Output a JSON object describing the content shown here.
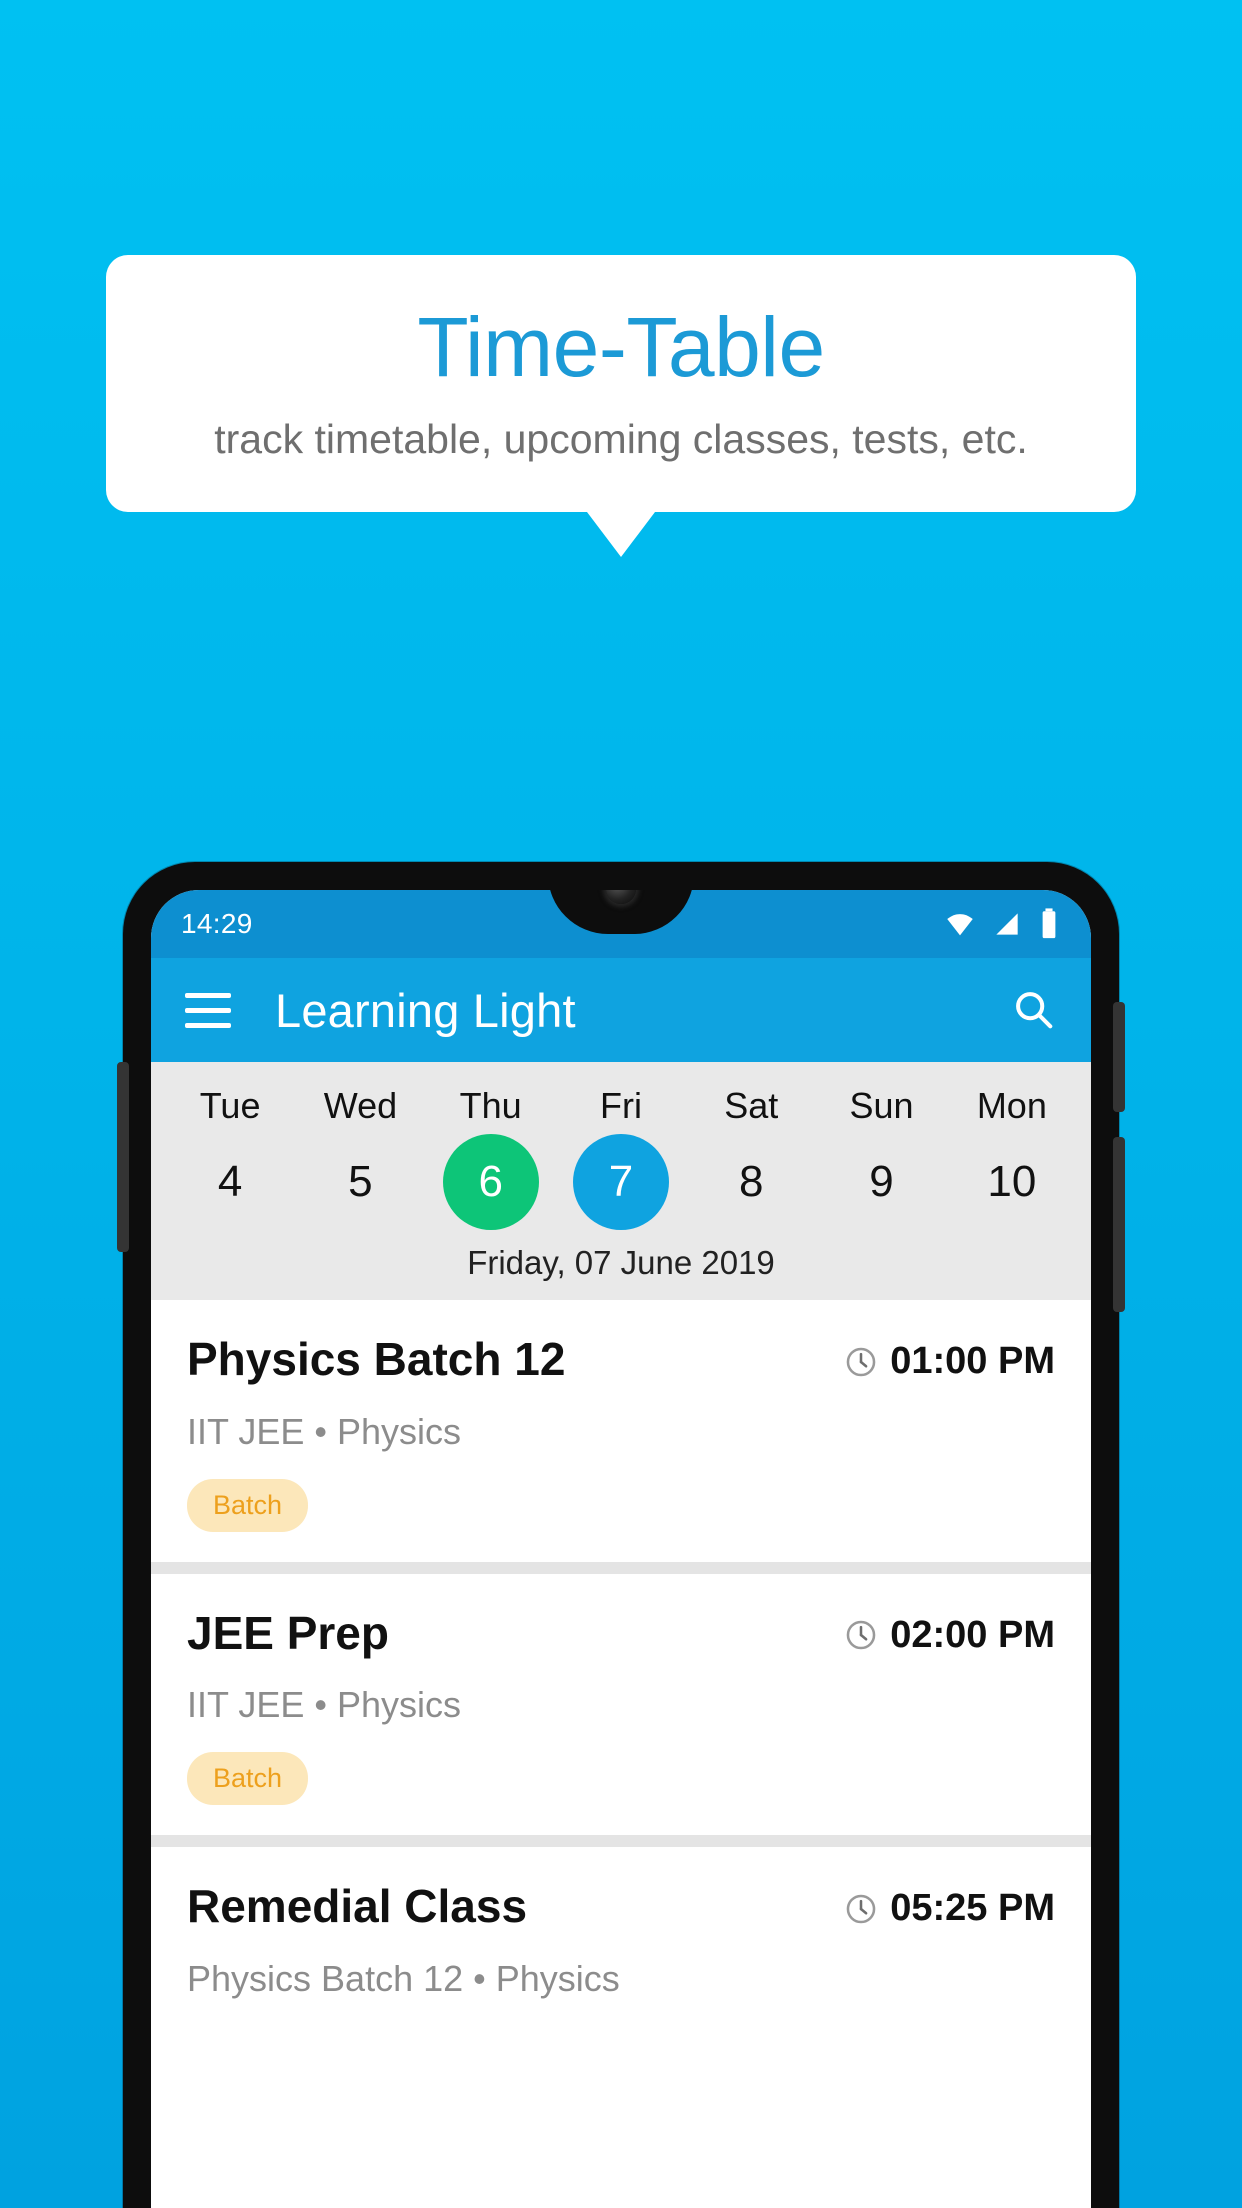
{
  "promo": {
    "title": "Time-Table",
    "subtitle": "track timetable, upcoming classes, tests, etc.",
    "title_color": "#1c9ad6",
    "background_color": "#00b4ea"
  },
  "statusbar": {
    "time": "14:29",
    "icons": [
      "wifi-icon",
      "signal-icon",
      "battery-icon"
    ]
  },
  "appbar": {
    "menu_icon": "hamburger-menu-icon",
    "title": "Learning Light",
    "search_icon": "search-icon",
    "color": "#0fa3e0"
  },
  "datestrip": {
    "days": [
      {
        "name": "Tue",
        "num": "4",
        "state": "normal"
      },
      {
        "name": "Wed",
        "num": "5",
        "state": "normal"
      },
      {
        "name": "Thu",
        "num": "6",
        "state": "today"
      },
      {
        "name": "Fri",
        "num": "7",
        "state": "selected"
      },
      {
        "name": "Sat",
        "num": "8",
        "state": "normal"
      },
      {
        "name": "Sun",
        "num": "9",
        "state": "normal"
      },
      {
        "name": "Mon",
        "num": "10",
        "state": "normal"
      }
    ],
    "selected_date_label": "Friday, 07 June 2019",
    "today_color": "#0dc578",
    "selected_color": "#0fa3e0"
  },
  "classes": [
    {
      "title": "Physics Batch 12",
      "time": "01:00 PM",
      "subtitle": "IIT JEE • Physics",
      "badge": "Batch"
    },
    {
      "title": "JEE Prep",
      "time": "02:00 PM",
      "subtitle": "IIT JEE • Physics",
      "badge": "Batch"
    },
    {
      "title": "Remedial Class",
      "time": "05:25 PM",
      "subtitle": "Physics Batch 12 • Physics",
      "badge": ""
    }
  ],
  "badge_colors": {
    "background": "#fce7ba",
    "text": "#eda01d"
  }
}
